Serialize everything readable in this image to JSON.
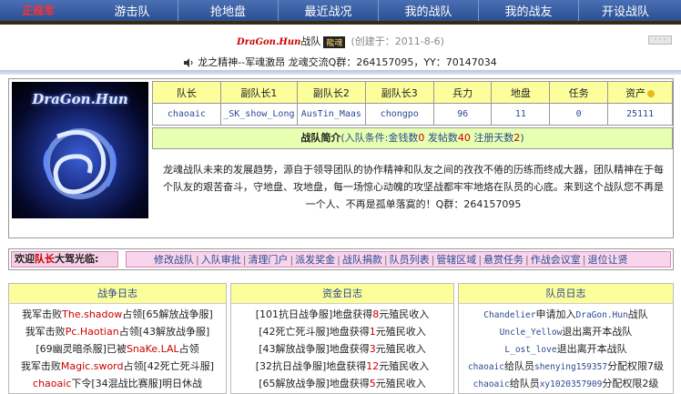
{
  "nav": {
    "logo": "正规军",
    "items": [
      "游击队",
      "抢地盘",
      "最近战况",
      "我的战队",
      "我的战友",
      "开设战队"
    ]
  },
  "header": {
    "team_name": "DraGon.Hun",
    "suffix": "战队",
    "badge": "龍魂",
    "founded": "(创建于：2011-8-6)",
    "more": "· · ·",
    "motto": "龙之精神--军魂激昂 龙魂交流Q群：264157095，YY：70147034"
  },
  "avatar": {
    "text": "DraGon.Hun"
  },
  "stats": {
    "headers": [
      "队长",
      "副队长1",
      "副队长2",
      "副队长3",
      "兵力",
      "地盘",
      "任务",
      "资产"
    ],
    "values": [
      "chaoaic",
      "_SK_show_Long",
      "AusTin_Maas",
      "chongpo",
      "96",
      "11",
      "0",
      "25111"
    ]
  },
  "intro": {
    "title": "战队简介",
    "cond_prefix": "(入队条件:金钱数",
    "money": "0",
    "posts_label": "发帖数",
    "posts": "40",
    "days_label": "注册天数",
    "days": "2",
    "cond_suffix": ")",
    "body": "龙魂战队未来的发展趋势，源自于领导团队的协作精神和队友之间的孜孜不倦的历练而终成大器，团队精神在于每个队友的艰苦奋斗，守地盘、攻地盘，每一场惊心动魄的攻坚战都牢牢地烙在队员的心底。来到这个战队您不再是一个人、不再是孤单落寞的！Q群：264157095"
  },
  "welcome": {
    "pre": "欢迎",
    "role": "队长",
    "post": "大驾光临:"
  },
  "actions": [
    "修改战队",
    "入队审批",
    "清理门户",
    "派发奖金",
    "战队捐款",
    "队员列表",
    "管辖区域",
    "悬赏任务",
    "作战会议室",
    "退位让贤"
  ],
  "logs": {
    "war": {
      "title": "战争日志",
      "lines": [
        [
          "我军击败",
          "The.shadow",
          "占领[65解放战争服]"
        ],
        [
          "我军击败",
          "Pc.Haotian",
          "占领[43解放战争服]"
        ],
        [
          "[69幽灵暗杀服]已被",
          "SnaKe.LAL",
          "占领"
        ],
        [
          "我军击败",
          "Magic.sword",
          "占领[42死亡死斗服]"
        ],
        [
          "",
          "chaoaic",
          "下令[34混战比赛服]明日休战"
        ]
      ]
    },
    "funds": {
      "title": "资金日志",
      "lines": [
        [
          "[101抗日战争服]地盘获得",
          "8",
          "元殖民收入"
        ],
        [
          "[42死亡死斗服]地盘获得",
          "1",
          "元殖民收入"
        ],
        [
          "[43解放战争服]地盘获得",
          "3",
          "元殖民收入"
        ],
        [
          "[32抗日战争服]地盘获得",
          "12",
          "元殖民收入"
        ],
        [
          "[65解放战争服]地盘获得",
          "5",
          "元殖民收入"
        ]
      ]
    },
    "members": {
      "title": "队员日志",
      "lines": [
        [
          "Chandelier",
          "申请加入",
          "DraGon.Hun",
          "战队"
        ],
        [
          "Uncle_Yellow",
          "退出离开本战队",
          "",
          ""
        ],
        [
          "L_ost_love",
          "退出离开本战队",
          "",
          ""
        ],
        [
          "chaoaic",
          "给队员",
          "shenying159357",
          "分配权限7级"
        ],
        [
          "chaoaic",
          "给队员",
          "xy1020357909",
          "分配权限2级"
        ]
      ]
    }
  }
}
